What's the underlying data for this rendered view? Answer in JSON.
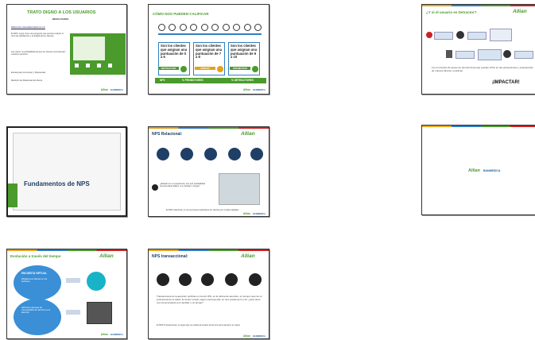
{
  "slides": {
    "s1": {
      "title": "TRATO DIGNO A LOS USUARIOS",
      "subtitle": "RESULTADOS",
      "link": "Referencia: www.allianzsalud.com.co",
      "p1": "El NPS, surge como una pregunta que permite evaluar el nivel de satisfacción y la lealtad de los clientes.",
      "p2": "Así mismo, la probabilidad de que los clientes recomienden nuestros servicios.",
      "p3": "Escala para Comunicar y Respuestas",
      "p4": "Medición de Relacional del cliente",
      "brand": "Allian"
    },
    "s2": {
      "title": "CÓMO NOS PUEDEN CALIFICAR",
      "box1": "Son los clientes que asignan una puntuación de 0 a 6",
      "box2": "Son los clientes que asignan una puntuación de 7 a 8",
      "box3": "Son los clientes que asignan una puntuación de 9 a 10",
      "tag1": "DETRACTOR",
      "tag2": "PASIVO",
      "tag3": "PROMOTOR",
      "band1": "NPS",
      "band2": "% PROMOTORES",
      "band3": "% DETRACTORES"
    },
    "s3": {
      "title": "¿Y si el usuario es Detractor?",
      "caption": "Los momentos de apoyo de primera línea que pueden influir en las percepciones y experiencias de manera directa y positivas",
      "impact": "¡IMPACTAR!"
    },
    "s4": {
      "title": "Fundamentos de NPS"
    },
    "s5": {
      "title": "NPS Relacional:",
      "question": "¿Basado en su experiencia, con qué probabilidad recomendaría Allianz a un familiar o amigo?",
      "note": "El NPS relacional, es una encuesta realizada a los clientes por medios digitales"
    },
    "s6": {
      "brand": "Allian",
      "partner": "BANMEDICA"
    },
    "s7": {
      "title": "Evolución a través del tiempo",
      "bubble1": "ENCUESTA VIRTUAL",
      "bubble1b": "Dirigida a los clientes en los procesos",
      "bubble2": "NPS de la atención de Comunidades de Servicio en la atención"
    },
    "s8": {
      "title": "NPS transaccional:",
      "body": "Transaccional es la atención recibida en Centro IPS, en la oficina de atención, en tiempo real con el profesional de la salud, al Centro virtual, según corresponda, en una escala de 0 a 10. ¿Qué tanto nos recomendaría a un familiar o un amigo?",
      "note": "El NPS Transaccional, es aquel que se realiza al usuario al término de la atención en salud"
    }
  },
  "brand": {
    "name": "Allian",
    "suffix": "lud",
    "partner": "BANMEDICA"
  },
  "colors": {
    "green": "#4a9a2c",
    "navy": "#1f3f66",
    "blue": "#2f7fc1",
    "orange": "#e6a11a"
  }
}
